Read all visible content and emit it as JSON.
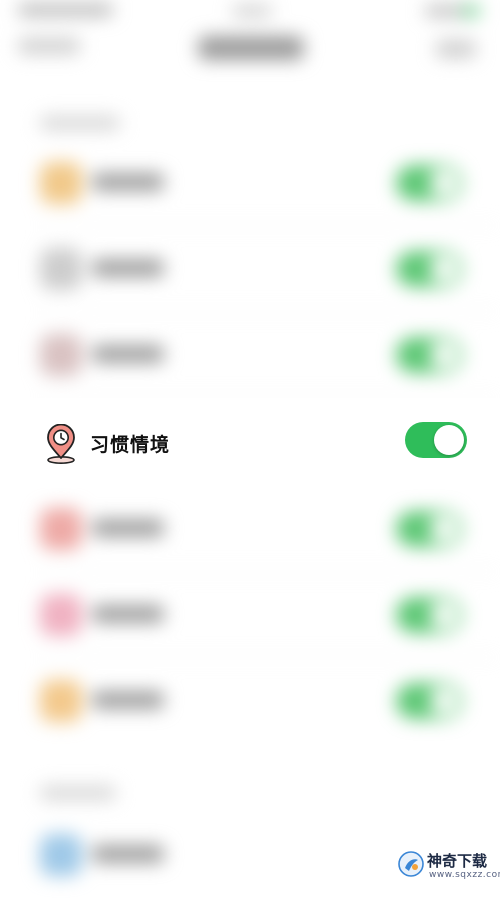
{
  "setting": {
    "label": "习惯情境",
    "enabled": true,
    "accent": "#2fbd5a",
    "icon": "location-pin-clock-icon"
  },
  "watermark": {
    "name": "神奇下载",
    "url": "www.sqxzz.com"
  }
}
